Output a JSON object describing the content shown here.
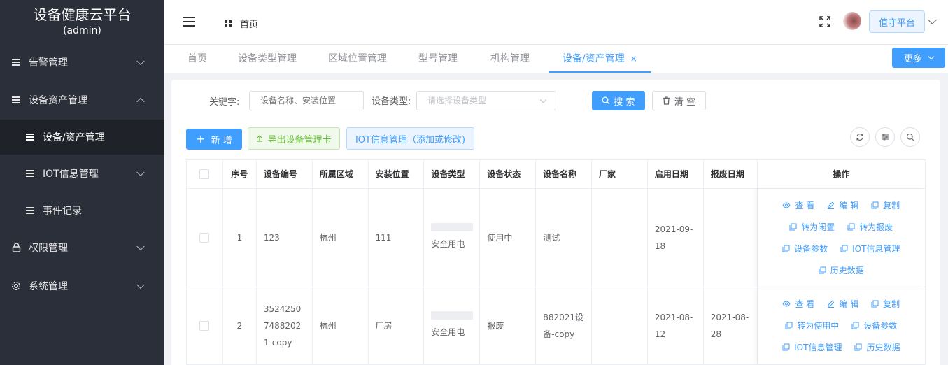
{
  "sidebar": {
    "brand_title": "设备健康云平台",
    "brand_sub": "(admin)",
    "items": [
      {
        "label": "告警管理"
      },
      {
        "label": "设备资产管理"
      },
      {
        "label": "设备/资产管理"
      },
      {
        "label": "IOT信息管理"
      },
      {
        "label": "事件记录"
      },
      {
        "label": "权限管理"
      },
      {
        "label": "系统管理"
      }
    ]
  },
  "header": {
    "breadcrumb": "首页",
    "duty_label": "值守平台"
  },
  "tabs": [
    {
      "label": "首页"
    },
    {
      "label": "设备类型管理"
    },
    {
      "label": "区域位置管理"
    },
    {
      "label": "型号管理"
    },
    {
      "label": "机构管理"
    },
    {
      "label": "设备/资产管理",
      "close": "×"
    }
  ],
  "more_label": "更多",
  "search": {
    "keyword_label": "关键字:",
    "keyword_placeholder": "设备名称、安装位置",
    "type_label": "设备类型:",
    "type_placeholder": "请选择设备类型",
    "search_btn": "搜 索",
    "clear_btn": "清 空"
  },
  "toolbar": {
    "add_btn": "新 增",
    "export_btn": "导出设备管理卡",
    "iot_btn": "IOT信息管理（添加或修改)"
  },
  "table": {
    "columns": [
      "序号",
      "设备编号",
      "所属区域",
      "安装位置",
      "设备类型",
      "设备状态",
      "设备名称",
      "厂家",
      "启用日期",
      "报废日期",
      "操作"
    ],
    "rows": [
      {
        "index": "1",
        "code": "123",
        "region": "杭州",
        "location": "111",
        "type": "安全用电",
        "status": "使用中",
        "name": "测试",
        "vendor": "",
        "start": "2021-09-18",
        "scrap": "",
        "ops": [
          [
            "查 看",
            "编 辑",
            "复制"
          ],
          [
            "转为闲置",
            "转为报废"
          ],
          [
            "设备参数",
            "IOT信息管理"
          ],
          [
            "历史数据"
          ]
        ]
      },
      {
        "index": "2",
        "code": "352425074882021-copy",
        "region": "杭州",
        "location": "厂房",
        "type": "安全用电",
        "status": "报废",
        "name": "882021设备-copy",
        "vendor": "",
        "start": "2021-08-12",
        "scrap": "2021-08-28",
        "ops": [
          [
            "查 看",
            "编 辑",
            "复制"
          ],
          [
            "转为使用中",
            "设备参数"
          ],
          [
            "IOT信息管理",
            "历史数据"
          ]
        ]
      }
    ]
  },
  "colors": {
    "primary": "#409eff",
    "sidebar_bg": "#2b2f3a",
    "success": "#67c23a"
  }
}
